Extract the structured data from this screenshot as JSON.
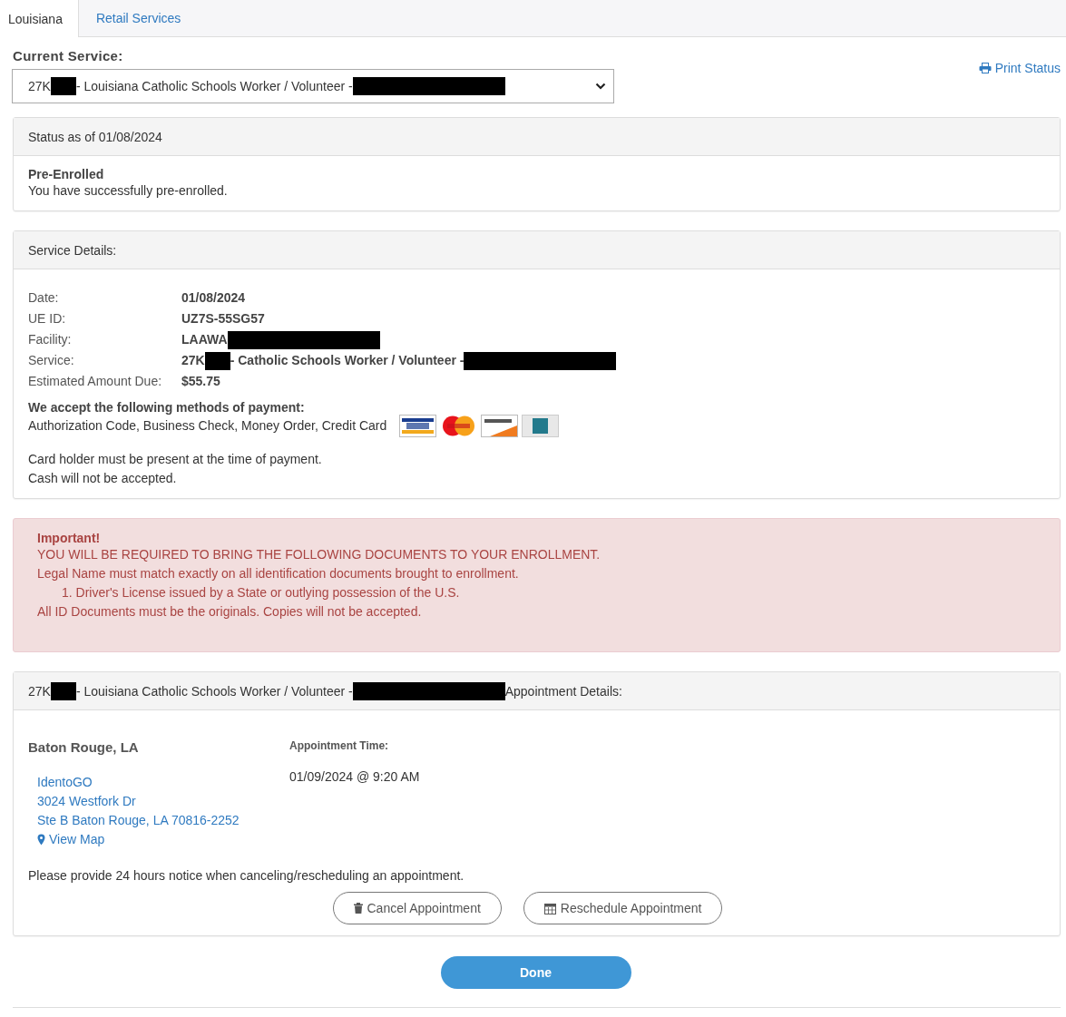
{
  "tabs": [
    {
      "label": "Louisiana",
      "selected": true
    },
    {
      "label": "Retail Services",
      "selected": false
    }
  ],
  "current_service": {
    "label": "Current Service:",
    "parts": [
      {
        "kind": "text",
        "text": "27K"
      },
      {
        "kind": "short_redaction"
      },
      {
        "kind": "text",
        "text": "- Louisiana Catholic Schools Worker / Volunteer -"
      },
      {
        "kind": "long_redaction"
      }
    ]
  },
  "print_link": "Print Status",
  "status": {
    "heading": "Status as of 01/08/2024",
    "title": "Pre-Enrolled",
    "message": "You have successfully pre-enrolled."
  },
  "service_details": {
    "heading": "Service Details:",
    "rows": [
      {
        "label": "Date:",
        "parts": [
          {
            "kind": "text",
            "text": "01/08/2024"
          }
        ]
      },
      {
        "label": "UE ID:",
        "parts": [
          {
            "kind": "text",
            "text": "UZ7S-55SG57"
          }
        ]
      },
      {
        "label": "Facility:",
        "parts": [
          {
            "kind": "text",
            "text": "LAAWA"
          },
          {
            "kind": "long_redaction"
          }
        ]
      },
      {
        "label": "Service:",
        "parts": [
          {
            "kind": "text",
            "text": "27K"
          },
          {
            "kind": "short_redaction"
          },
          {
            "kind": "text",
            "text": " - Catholic Schools Worker / Volunteer -"
          },
          {
            "kind": "long_redaction"
          }
        ]
      },
      {
        "label": "Estimated Amount Due:",
        "parts": [
          {
            "kind": "text",
            "text": "$55.75"
          }
        ]
      }
    ],
    "payment_heading": "We accept the following methods of payment:",
    "payment_methods": "Authorization Code, Business Check, Money Order, Credit Card",
    "notes": [
      "Card holder must be present at the time of payment.",
      "Cash will not be accepted."
    ]
  },
  "alert": {
    "title": "Important!",
    "lines": [
      {
        "kind": "line",
        "text": "YOU WILL BE REQUIRED TO BRING THE FOLLOWING DOCUMENTS TO YOUR ENROLLMENT."
      },
      {
        "kind": "line",
        "text": "Legal Name must match exactly on all identification documents brought to enrollment."
      },
      {
        "kind": "item",
        "text": "1. Driver's License issued by a State or outlying possession of the U.S."
      },
      {
        "kind": "line",
        "text": "All ID Documents must be the originals. Copies will not be accepted."
      }
    ]
  },
  "appointment": {
    "heading_parts": [
      {
        "kind": "text",
        "text": "27K"
      },
      {
        "kind": "short_redaction"
      },
      {
        "kind": "text",
        "text": "- Louisiana Catholic Schools Worker / Volunteer -"
      },
      {
        "kind": "long_redaction"
      },
      {
        "kind": "text",
        "text": "Appointment Details:"
      }
    ],
    "city": "Baton Rouge, LA",
    "location_name": "IdentoGO",
    "address_lines": [
      "3024 Westfork Dr",
      "Ste B Baton Rouge, LA 70816-2252"
    ],
    "map_link": "View Map",
    "time_label": "Appointment Time:",
    "time": "01/09/2024 @ 9:20 AM",
    "notice": "Please provide 24 hours notice when canceling/rescheduling an appointment.",
    "buttons": [
      {
        "kind": "cancel",
        "label": "Cancel Appointment"
      },
      {
        "kind": "reschedule",
        "label": "Reschedule Appointment"
      }
    ]
  },
  "done_button": "Done"
}
